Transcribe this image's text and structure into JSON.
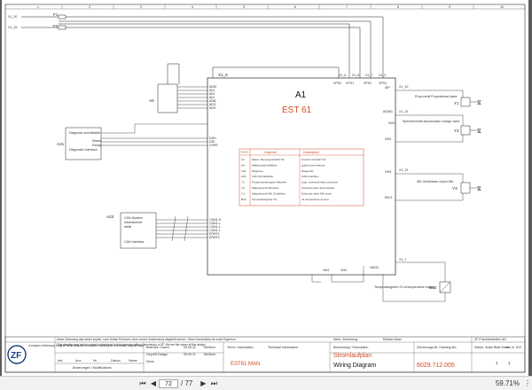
{
  "header": {
    "columns": [
      "1",
      "2",
      "3",
      "4",
      "5",
      "6",
      "7",
      "8",
      "9",
      "10"
    ]
  },
  "supply": {
    "f1": "F1",
    "f2": "F2",
    "f1_ref": "X1_30",
    "f2_ref": "X1_15"
  },
  "a1": {
    "label": "A1",
    "name": "EST 61",
    "top_pins": [
      "X1_9",
      "VPS2",
      "VPS1",
      "VPS2",
      "VPS1"
    ],
    "top_pin_nums": [
      "X1_6",
      "X1_8",
      "X1_7",
      "X1_2"
    ],
    "left_pins_a6": [
      "ADM",
      "ADI",
      "ADI",
      "ADI",
      "ADB",
      "ADS",
      "ADS"
    ],
    "left_pins_a21": [
      "DDH",
      "DDI",
      "DVPE"
    ],
    "can_pins": [
      "CAN1-H",
      "CAN1-L",
      "CAN1-L",
      "CAN1-L",
      "ERRF1",
      "ERRF2"
    ],
    "right_pins": [
      "AIP",
      "ADMG",
      "VM1",
      "VM4",
      "EM 6"
    ],
    "bottom_pins": [
      "VM1",
      "VM1",
      "VMG2"
    ],
    "misc": [
      "VM1"
    ]
  },
  "legend": {
    "col1_header": "Legende",
    "col2_header": "Description",
    "rows": [
      {
        "code": "A1",
        "de": "Elektr. Steuergerät EST 61",
        "en": "Control Unit EST 61"
      },
      {
        "code": "A6",
        "de": "Wählschalter/Wähler",
        "en": "guide level selector"
      },
      {
        "code": "A21",
        "de": "Diagnose",
        "en": "Diagnosis"
      },
      {
        "code": "A23",
        "de": "CAN Schnittstelle",
        "en": "CAN Interface"
      },
      {
        "code": "Y1",
        "de": "Proportionalmagnet Wandler",
        "en": "prop. solenoid valve converter"
      },
      {
        "code": "Y2",
        "de": "Magnetventil Speicher",
        "en": "solenoid valve accumulator"
      },
      {
        "code": "Y3",
        "de": "Magnetventil WK Schließen",
        "en": "Solenoid valve WK close"
      },
      {
        "code": "B12",
        "de": "Temperaturgeber ÖL",
        "en": "oil temperature sensor"
      }
    ]
  },
  "components": {
    "a6": "A6",
    "a21": "A21",
    "a21_title": "Diagnose-schnittstelle",
    "a21_sub": "Diagnostic Interface",
    "a21_pins": [
      "Masse",
      "Ready"
    ],
    "a23": "A23",
    "a23_title": "CAN-System",
    "a23_line2": "elektrischnitt",
    "a23_line3": "stelle",
    "a23_line4": "CAN Interface",
    "y1": "Y1",
    "y1_text": "Prop-ventil Propertional-Valve",
    "y1_ref": "X1_10",
    "y2": "Y2",
    "y2_text": "Speicherventil accumulator charge valve",
    "y2_ref": "X1_16",
    "y3": "Y3",
    "y3_text": "WK-Schliessen clutch WK",
    "y3_ref": "X1_15",
    "b12": "B12",
    "b12_text": "Temperaturgeber Öl oil temperature sensor",
    "b12_ref": "X1_7"
  },
  "title_block": {
    "note_de": "Diese Zeichnung darf weder kopiert, noch Dritten Personen ohne unsere Zustimmung mitgeteilt werden. Diese Konstruktion ist unser Eigentum",
    "note_en": "This drawing may not be copied or disclosed to third persons without permission of ZF. We are the owner of this design",
    "left_text": "Computer-Zeichnung Original nicht verändern computer drawing do not modify original copy",
    "columns": [
      "Ind.",
      "Anz.",
      "Nr.",
      "Datum",
      "Name"
    ],
    "change_label": "Änderungen / Modifications",
    "bearbeitet": "Bearbeit. Drawn",
    "geprueft": "Geprüft Design",
    "norm": "Norm",
    "dates": [
      "09.09.11",
      "09.09.11"
    ],
    "names": [
      "Meißner",
      "Meißner"
    ],
    "techn_info": "Techn. Information",
    "techn_info_en": "Technical Information",
    "sheet_text": "EST61 MAN",
    "ben_label": "Benennung / Description",
    "title_de": "Stromlaufplan",
    "title_en": "Wiring Diagram",
    "zeichnungs_label": "Zeichnungs-Nr. Drawing-No.",
    "drawing_no": "6029.712.005",
    "maker": "ZF Friedrichshafen AG",
    "massstab": "Maßst. Scale",
    "blatt": "Blatt Sheet",
    "von": "von of",
    "idx": "IDX",
    "blatt_val": "1",
    "von_val": "1",
    "werk": "Werk. Zeichnung",
    "werk_val": "Ekkkter Alaw"
  },
  "viewer": {
    "page_current": "72",
    "page_total": "/ 77",
    "zoom": "59.71%"
  }
}
